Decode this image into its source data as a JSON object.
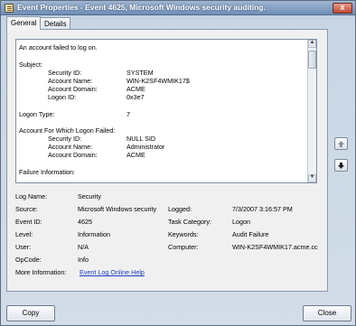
{
  "window": {
    "title": "Event Properties - Event 4625, Microsoft Windows security auditing.",
    "close_glyph": "x"
  },
  "tabs": [
    {
      "label": "General",
      "active": true
    },
    {
      "label": "Details",
      "active": false
    }
  ],
  "message": {
    "lines": [
      "An account failed to log on.",
      "Subject:",
      "Security ID:",
      "SYSTEM",
      "Account Name:",
      "WIN-K2SF4WMIK17$",
      "Account Domain:",
      "ACME",
      "Logon ID:",
      "0x3e7",
      "Logon Type:",
      "7",
      "Account For Which Logon Failed:",
      "Security ID:",
      "NULL SID",
      "Account Name:",
      "Administrator",
      "Account Domain:",
      "ACME",
      "Failure Information:"
    ]
  },
  "properties": {
    "log_name_label": "Log Name:",
    "log_name": "Security",
    "source_label": "Source:",
    "source": "Microsoft Windows security",
    "logged_label": "Logged:",
    "logged": "7/3/2007 3:16:57 PM",
    "event_id_label": "Event ID:",
    "event_id": "4625",
    "task_category_label": "Task Category:",
    "task_category": "Logon",
    "level_label": "Level:",
    "level": "Information",
    "keywords_label": "Keywords:",
    "keywords": "Audit Failure",
    "user_label": "User:",
    "user": "N/A",
    "computer_label": "Computer:",
    "computer": "WIN-K2SF4WMIK17.acme.cc",
    "opcode_label": "OpCode:",
    "opcode": "Info",
    "more_info_label": "More Information:",
    "more_info_link": "Event Log Online Help"
  },
  "buttons": {
    "copy": "Copy",
    "close": "Close"
  },
  "colors": {
    "titlebar": "#6f8fb6",
    "close_button": "#c24a33",
    "link": "#1a3fbf"
  },
  "icons": [
    "event-properties-icon",
    "close-icon",
    "scroll-up-icon",
    "scroll-down-icon",
    "previous-event-icon",
    "next-event-icon"
  ]
}
